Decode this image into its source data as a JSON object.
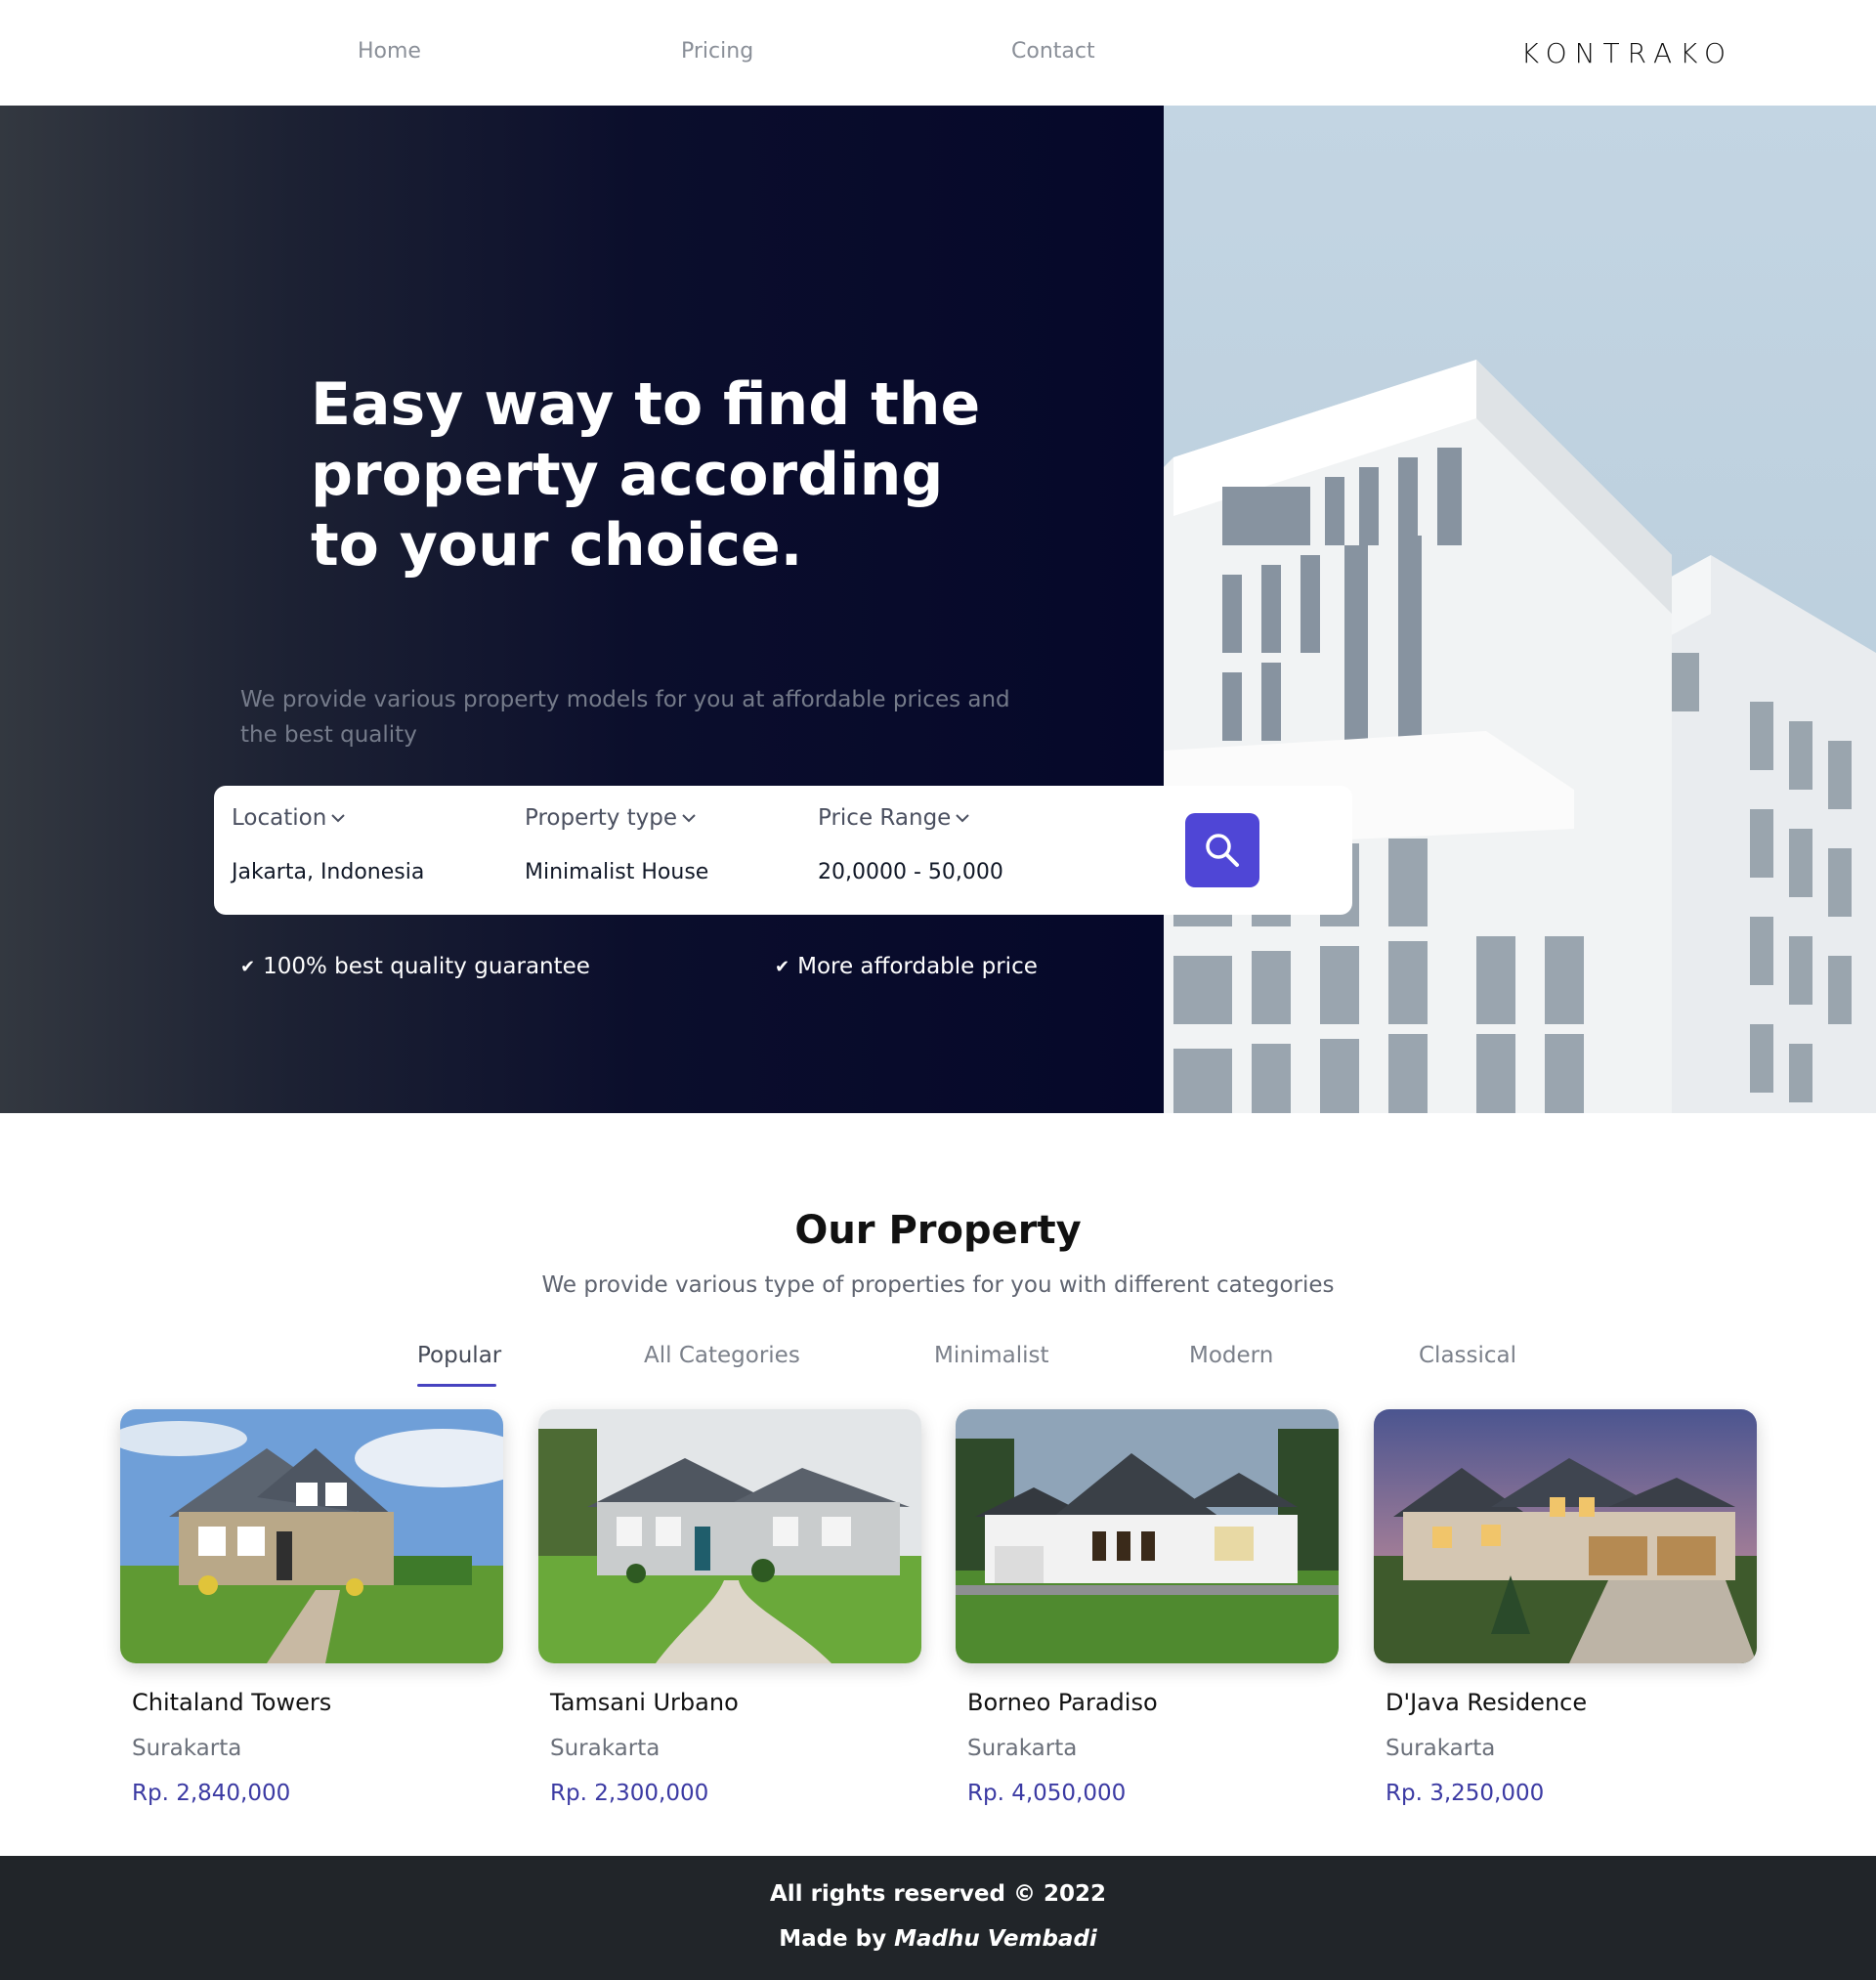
{
  "nav": {
    "links": [
      "Home",
      "Pricing",
      "Contact"
    ],
    "brand": "KONTRAKO"
  },
  "hero": {
    "title": "Easy way to find the property according to your choice.",
    "subtitle": "We provide various property models for you at affordable prices and the best quality",
    "search": {
      "fields": [
        {
          "label": "Location",
          "value": "Jakarta, Indonesia"
        },
        {
          "label": "Property type",
          "value": "Minimalist House"
        },
        {
          "label": "Price Range",
          "value": "20,0000 - 50,000"
        }
      ],
      "button_icon": "search-icon"
    },
    "features": [
      "100% best quality guarantee",
      "More affordable price"
    ]
  },
  "property": {
    "title": "Our Property",
    "subtitle": "We provide various type of properties for you with different categories",
    "tabs": [
      "Popular",
      "All Categories",
      "Minimalist",
      "Modern",
      "Classical"
    ],
    "active_tab": "Popular",
    "cards": [
      {
        "name": "Chitaland Towers",
        "city": "Surakarta",
        "price": "Rp. 2,840,000"
      },
      {
        "name": "Tamsani Urbano",
        "city": "Surakarta",
        "price": "Rp. 2,300,000"
      },
      {
        "name": "Borneo Paradiso",
        "city": "Surakarta",
        "price": "Rp. 4,050,000"
      },
      {
        "name": "D'Java Residence",
        "city": "Surakarta",
        "price": "Rp. 3,250,000"
      }
    ]
  },
  "footer": {
    "rights": "All rights reserved © 2022",
    "made_by_prefix": "Made by",
    "author": "Madhu Vembadi"
  },
  "colors": {
    "accent": "#4f46d6",
    "price": "#3b3aa3",
    "hero_dark": "#05082a",
    "footer_bg": "#212529"
  }
}
